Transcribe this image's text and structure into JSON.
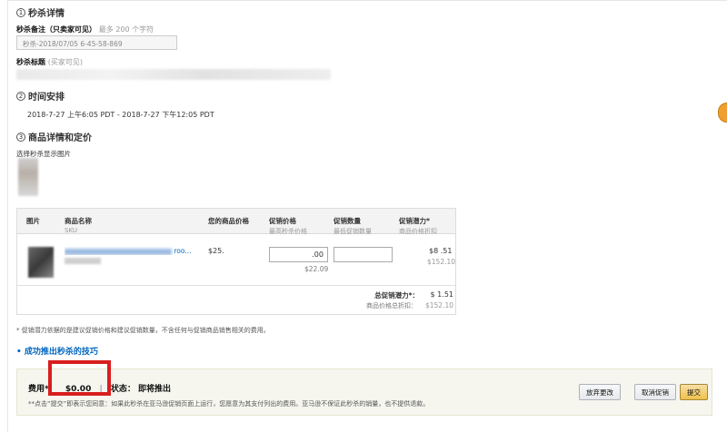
{
  "section1": {
    "num": "1",
    "title": "秒杀详情"
  },
  "note": {
    "label": "秒杀备注（只卖家可见）",
    "hint": "最多 200 个字符",
    "value": "秒杀-2018/07/05 6-45-58-869"
  },
  "deal_title": {
    "label": "秒杀标题",
    "hint": "(买家可见)"
  },
  "section2": {
    "num": "2",
    "title": "时间安排"
  },
  "schedule": {
    "text": "2018-7-27 上午6:05 PDT  -  2018-7-27 下午12:05 PDT"
  },
  "section3": {
    "num": "3",
    "title": "商品详情和定价"
  },
  "image_select": {
    "label": "选择秒杀显示图片"
  },
  "table": {
    "headers": {
      "image": "图片",
      "name": "商品名称",
      "sku": "SKU",
      "your_price": "您的商品价格",
      "deal_price": "促销价格",
      "deal_price_sub": "最高秒杀价格",
      "deal_qty": "促销数量",
      "deal_qty_sub": "最低促销数量",
      "potential": "促销潜力*",
      "potential_sub": "商品价格折扣"
    },
    "row": {
      "name_suffix": "roo...",
      "your_price": "$25.",
      "deal_price_input": ".00",
      "deal_price_below": "$22.09",
      "potential": "$8    .51",
      "potential_price": "$152.10"
    },
    "total_label": "总促销潜力*：",
    "total_value": "$     1.51",
    "total_price_label": "商品价格总折扣：",
    "total_price_value": "$152.10"
  },
  "footnote": "* 促销潜力依据的是建议促销价格和建议促销数量，不含任何与促销商品销售相关的费用。",
  "tips_link": "• 成功推出秒杀的技巧",
  "bottom": {
    "fee_label": "费用*：",
    "fee_value": "$0.00",
    "status": "状态：  即将推出",
    "note": "**点击“提交”即表示您同意：如果此秒杀在亚马逊促销页面上运行，您愿意为其支付列出的费用。亚马逊不保证此秒杀的销量，也不提供退款。",
    "btn_discard": "放弃更改",
    "btn_cancel": "取消促销",
    "btn_submit": "提交"
  },
  "colors": {
    "link": "#0066c0",
    "highlight": "#d81e1e",
    "primary_button": "#f0c14b"
  }
}
